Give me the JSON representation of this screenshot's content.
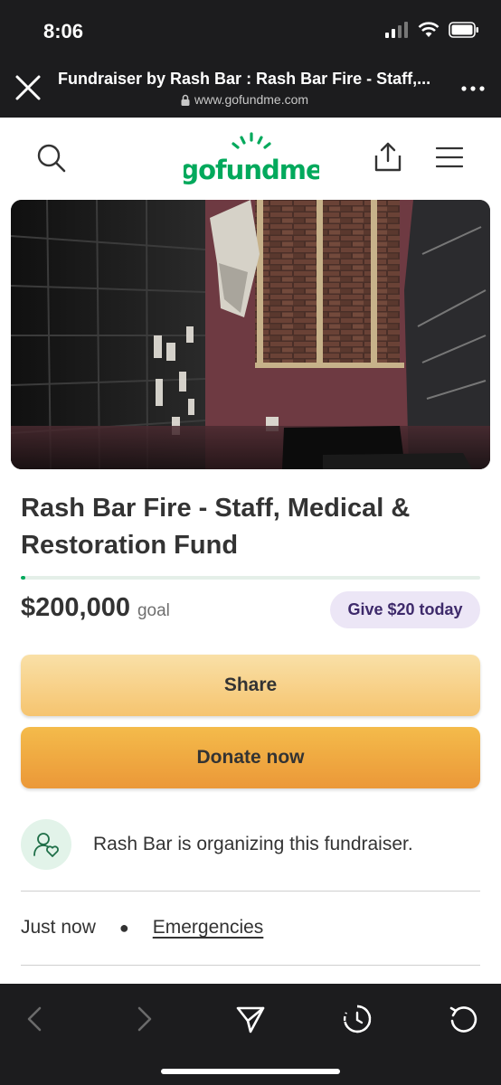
{
  "status_bar": {
    "time": "8:06"
  },
  "browser": {
    "page_title": "Fundraiser by Rash Bar : Rash Bar Fire - Staff,...",
    "url": "www.gofundme.com"
  },
  "header": {
    "logo_text": "gofundme",
    "brand_color": "#02a95c"
  },
  "campaign": {
    "title": "Rash Bar Fire - Staff, Medical & Restoration Fund",
    "goal_amount": "$200,000",
    "goal_label": "goal",
    "progress_fraction": 0.01,
    "give_label": "Give $20 today",
    "share_label": "Share",
    "donate_label": "Donate now",
    "organizer_text": "Rash Bar is organizing this fundraiser.",
    "posted": "Just now",
    "category": "Emergencies"
  },
  "icons": {
    "search": "search-icon",
    "share": "share-icon",
    "menu": "menu-icon",
    "organizer": "user-heart-icon",
    "back": "chevron-left-icon",
    "forward": "chevron-right-icon",
    "send": "send-icon",
    "history": "clock-icon",
    "reload": "reload-icon"
  }
}
